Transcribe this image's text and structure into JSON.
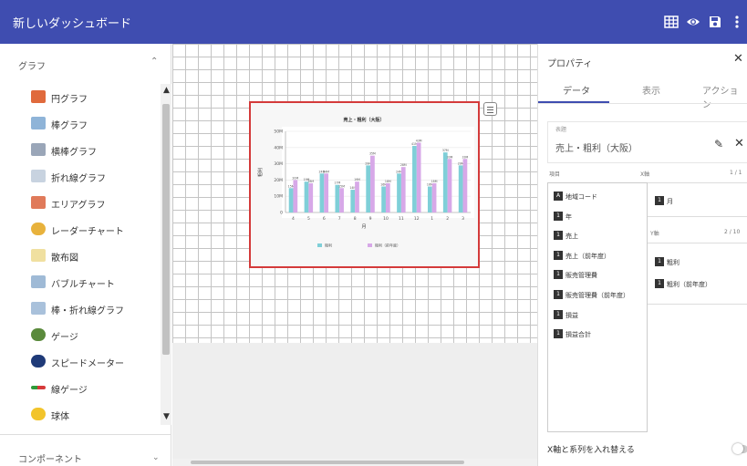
{
  "header": {
    "title": "新しいダッシュボード",
    "icons": [
      "grid-icon",
      "eye-icon",
      "save-icon",
      "more-vert-icon"
    ]
  },
  "left_panel": {
    "graph_section": "グラフ",
    "chart_types": [
      {
        "label": "円グラフ",
        "icon": "pie-chart-icon",
        "color": "#e06a3c"
      },
      {
        "label": "棒グラフ",
        "icon": "bar-chart-icon",
        "color": "#8fb4d8"
      },
      {
        "label": "横棒グラフ",
        "icon": "horizontal-bar-chart-icon",
        "color": "#9aa6b8"
      },
      {
        "label": "折れ線グラフ",
        "icon": "line-chart-icon",
        "color": "#c8d3e0"
      },
      {
        "label": "エリアグラフ",
        "icon": "area-chart-icon",
        "color": "#e07a5a"
      },
      {
        "label": "レーダーチャート",
        "icon": "radar-chart-icon",
        "color": "#e8b23c"
      },
      {
        "label": "散布図",
        "icon": "scatter-chart-icon",
        "color": "#f0e0a0"
      },
      {
        "label": "バブルチャート",
        "icon": "bubble-chart-icon",
        "color": "#9fbad6"
      },
      {
        "label": "棒・折れ線グラフ",
        "icon": "bar-line-chart-icon",
        "color": "#a9c1db"
      },
      {
        "label": "ゲージ",
        "icon": "gauge-icon",
        "color": "#5a8a3c"
      },
      {
        "label": "スピードメーター",
        "icon": "speedometer-icon",
        "color": "#1f3a78"
      },
      {
        "label": "線ゲージ",
        "icon": "linear-gauge-icon",
        "color": "#d63a3a"
      },
      {
        "label": "球体",
        "icon": "sphere-icon",
        "color": "#f2c42b"
      }
    ],
    "component_section": "コンポーネント"
  },
  "chart_data": {
    "type": "bar",
    "title": "売上・粗利（大阪）",
    "xlabel": "月",
    "ylabel": "粗利",
    "categories": [
      "4",
      "5",
      "6",
      "7",
      "8",
      "9",
      "10",
      "11",
      "12",
      "1",
      "2",
      "3"
    ],
    "series": [
      {
        "name": "粗利",
        "color": "#7fcfd8",
        "values": [
          15,
          19,
          24,
          17,
          14,
          29,
          16,
          24,
          41,
          16,
          37,
          29
        ]
      },
      {
        "name": "粗利（前年度）",
        "color": "#d7a8e8",
        "values": [
          20,
          18,
          24,
          15,
          19,
          35,
          18,
          28,
          43,
          18,
          33,
          33
        ]
      }
    ],
    "y_ticks": [
      "0",
      "10M",
      "20M",
      "30M",
      "40M",
      "50M"
    ],
    "ylim": [
      0,
      50
    ],
    "grid": true,
    "legend": "bottom"
  },
  "right_panel": {
    "title": "プロパティ",
    "tabs": [
      "データ",
      "表示",
      "アクション"
    ],
    "title_field_label": "表題",
    "title_value": "売上・粗利（大阪）",
    "items_label": "項目",
    "x_axis_label": "X軸",
    "x_axis_count": "1 / 1",
    "y_axis_label": "Y軸",
    "y_axis_count": "2 / 10",
    "fields": [
      {
        "type": "A",
        "label": "地域コード"
      },
      {
        "type": "1",
        "label": "年"
      },
      {
        "type": "1",
        "label": "売上"
      },
      {
        "type": "1",
        "label": "売上（前年度）"
      },
      {
        "type": "1",
        "label": "販売管理費"
      },
      {
        "type": "1",
        "label": "販売管理費（前年度）"
      },
      {
        "type": "1",
        "label": "損益"
      },
      {
        "type": "1",
        "label": "損益合計"
      }
    ],
    "x_axis_fields": [
      {
        "type": "1",
        "label": "月"
      }
    ],
    "y_axis_fields": [
      {
        "type": "1",
        "label": "粗利"
      },
      {
        "type": "1",
        "label": "粗利（前年度）"
      }
    ],
    "swap_label": "X軸と系列を入れ替える",
    "swap_on": false
  },
  "colors": {
    "header_bg": "#3f4db0",
    "selection_border": "#d43a3a",
    "tab_accent": "#3f4db0"
  }
}
